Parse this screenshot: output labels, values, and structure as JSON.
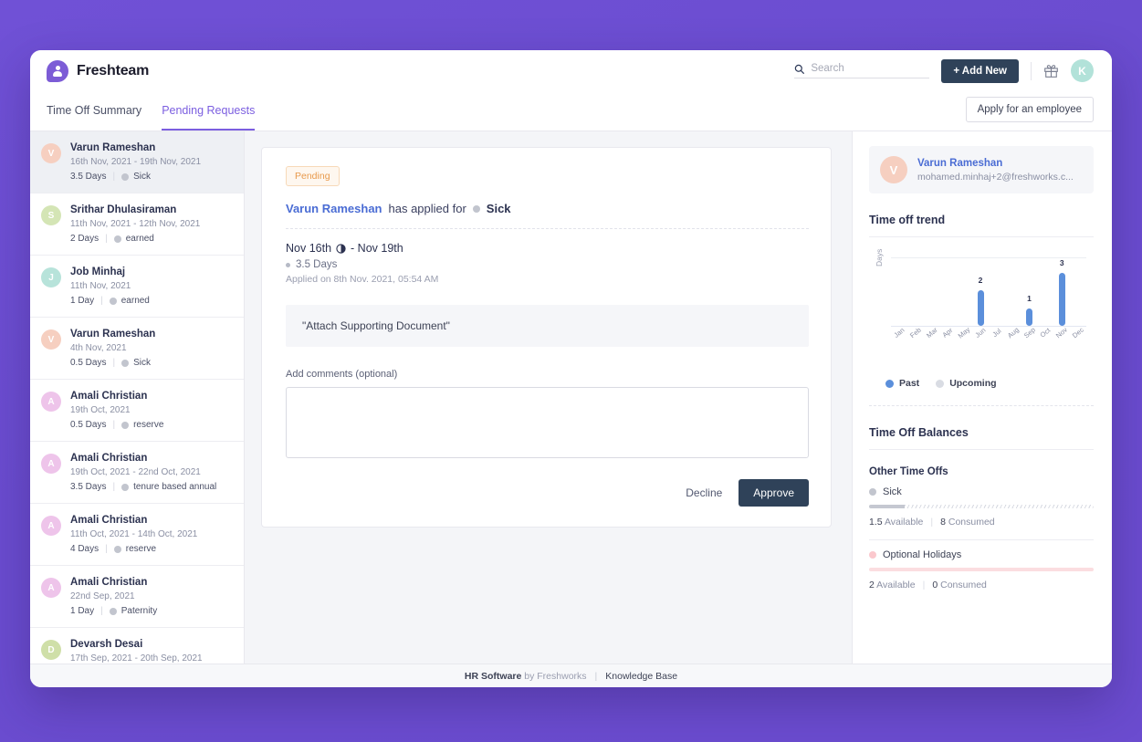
{
  "topbar": {
    "brand_name": "Freshteam",
    "logo_icon": "freshteam-person-logo",
    "search_placeholder": "Search",
    "search_value": "",
    "search_icon": "search-icon",
    "add_new_label": "+ Add New",
    "gift_icon": "gift-icon",
    "avatar_initial": "K",
    "accent_color": "#7b5ee0",
    "dark_button_color": "#2f4259"
  },
  "tabs": {
    "items": [
      {
        "label": "Time Off Summary",
        "active": false
      },
      {
        "label": "Pending Requests",
        "active": true
      }
    ],
    "apply_button_label": "Apply for an employee"
  },
  "sidebar": {
    "requests": [
      {
        "initial": "V",
        "avatar_color": "#f6cfc0",
        "name": "Varun Rameshan",
        "dates": "16th Nov, 2021 - 19th Nov, 2021",
        "duration": "3.5 Days",
        "type": "Sick",
        "selected": true
      },
      {
        "initial": "S",
        "avatar_color": "#d4e5b5",
        "name": "Srithar Dhulasiraman",
        "dates": "11th Nov, 2021 - 12th Nov, 2021",
        "duration": "2 Days",
        "type": "earned",
        "selected": false
      },
      {
        "initial": "J",
        "avatar_color": "#b7e3da",
        "name": "Job Minhaj",
        "dates": "11th Nov, 2021",
        "duration": "1 Day",
        "type": "earned",
        "selected": false
      },
      {
        "initial": "V",
        "avatar_color": "#f6cfc0",
        "name": "Varun Rameshan",
        "dates": "4th Nov, 2021",
        "duration": "0.5 Days",
        "type": "Sick",
        "selected": false
      },
      {
        "initial": "A",
        "avatar_color": "#eec4ea",
        "name": "Amali Christian",
        "dates": "19th Oct, 2021",
        "duration": "0.5 Days",
        "type": "reserve",
        "selected": false
      },
      {
        "initial": "A",
        "avatar_color": "#eec4ea",
        "name": "Amali Christian",
        "dates": "19th Oct, 2021 - 22nd Oct, 2021",
        "duration": "3.5 Days",
        "type": "tenure based annual",
        "selected": false
      },
      {
        "initial": "A",
        "avatar_color": "#eec4ea",
        "name": "Amali Christian",
        "dates": "11th Oct, 2021 - 14th Oct, 2021",
        "duration": "4 Days",
        "type": "reserve",
        "selected": false
      },
      {
        "initial": "A",
        "avatar_color": "#eec4ea",
        "name": "Amali Christian",
        "dates": "22nd Sep, 2021",
        "duration": "1 Day",
        "type": "Paternity",
        "selected": false
      },
      {
        "initial": "D",
        "avatar_color": "#cfdfa8",
        "name": "Devarsh Desai",
        "dates": "17th Sep, 2021 - 20th Sep, 2021",
        "duration": "",
        "type": "",
        "selected": false
      }
    ]
  },
  "request_detail": {
    "status_badge": "Pending",
    "applicant_name": "Varun Rameshan",
    "applied_for_text": "has applied for",
    "leave_type": "Sick",
    "leave_type_icon": "grey-dot-icon",
    "date_range": "Nov 16th",
    "date_range_end": "- Nov 19th",
    "half_day_icon": "half-moon-icon",
    "duration": "3.5 Days",
    "applied_on": "Applied on 8th Nov. 2021, 05:54 AM",
    "document_note": "\"Attach Supporting Document\"",
    "comments_label": "Add comments (optional)",
    "comments_value": "",
    "decline_label": "Decline",
    "approve_label": "Approve"
  },
  "right_panel": {
    "profile": {
      "initial": "V",
      "avatar_color": "#f6cfc0",
      "name": "Varun Rameshan",
      "email": "mohamed.minhaj+2@freshworks.c..."
    },
    "trend_title": "Time off trend",
    "balances_title": "Time Off Balances",
    "balance_group_title": "Other Time Offs",
    "balances": [
      {
        "name": "Sick",
        "dot_color": "#c2c5ce",
        "bar_color": "#c5c8d1",
        "filled_percent": 16,
        "available": "1.5",
        "available_label": "Available",
        "consumed": "8",
        "consumed_label": "Consumed"
      },
      {
        "name": "Optional Holidays",
        "dot_color": "#fbc8cd",
        "bar_color": "#fbdde0",
        "filled_percent": 0,
        "available": "2",
        "available_label": "Available",
        "consumed": "0",
        "consumed_label": "Consumed"
      }
    ]
  },
  "chart_data": {
    "type": "bar",
    "title": "Time off trend",
    "xlabel": "",
    "ylabel": "Days",
    "categories": [
      "Jan",
      "Feb",
      "Mar",
      "Apr",
      "May",
      "Jun",
      "Jul",
      "Aug",
      "Sep",
      "Oct",
      "Nov",
      "Dec"
    ],
    "values": [
      0,
      0,
      0,
      0,
      0,
      2,
      0,
      0,
      1,
      0,
      3,
      0
    ],
    "data_labels": [
      "",
      "",
      "",
      "",
      "",
      "2",
      "",
      "",
      "1",
      "",
      "3",
      ""
    ],
    "ylim": [
      0,
      3
    ],
    "grid": false,
    "bar_color": "#5b8fdb",
    "legend_position": "bottom",
    "legend": [
      {
        "name": "Past",
        "color": "#5b8fdb"
      },
      {
        "name": "Upcoming",
        "color": "#d9dce3"
      }
    ]
  },
  "footer": {
    "strong": "HR Software",
    "muted": "by Freshworks",
    "separator": "|",
    "link": "Knowledge Base"
  }
}
